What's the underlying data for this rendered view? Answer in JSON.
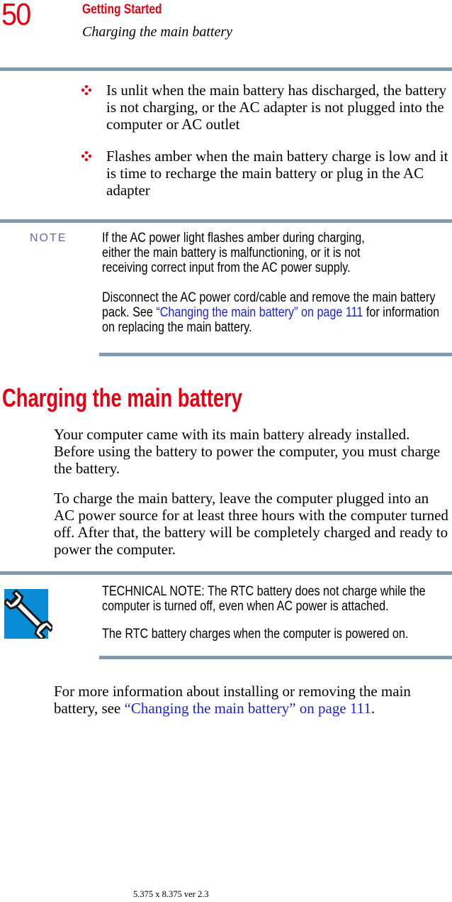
{
  "header": {
    "page_number": "50",
    "chapter": "Getting Started",
    "section": "Charging the main battery"
  },
  "bullets": [
    {
      "icon": "diamond-bullet-icon",
      "text": "Is unlit when the main battery has discharged, the battery is not charging, or the AC adapter is not plugged into the computer or AC outlet"
    },
    {
      "icon": "diamond-bullet-icon",
      "text": "Flashes amber when the main battery charge is low and it is time to recharge the main battery or plug in the AC adapter"
    }
  ],
  "note": {
    "label": "NOTE",
    "para1": "If the AC power light flashes amber during charging, either the main battery is malfunctioning, or it is not receiving correct input from the AC power supply.",
    "para2_prefix": "Disconnect the AC power cord/cable and remove the main battery pack. See ",
    "para2_link": "“Changing the main battery” on page 111",
    "para2_suffix": " for information on replacing the main battery."
  },
  "section": {
    "heading": "Charging the main battery",
    "para1": "Your computer came with its main battery already installed. Before using the battery to power the computer, you must charge the battery.",
    "para2": "To charge the main battery, leave the computer plugged into an AC power source for at least three hours with the computer turned off. After that, the battery will be completely charged and ready to power the computer."
  },
  "tech_note": {
    "icon": "wrench-icon",
    "para1": "TECHNICAL NOTE: The RTC battery does not charge while the computer is turned off, even when AC power is attached.",
    "para2": "The RTC battery charges when the computer is powered on."
  },
  "closing": {
    "prefix": "For more information about installing or removing the main battery, see ",
    "link": "“Changing the main battery” on page 111",
    "suffix": "."
  },
  "footer": "5.375 x 8.375 ver 2.3",
  "colors": {
    "accent_red": "#e60012",
    "rule_blue": "#7f9ab2",
    "link_blue": "#1c22d4",
    "note_label": "#6b66a8",
    "icon_blue": "#0a8bd6"
  }
}
